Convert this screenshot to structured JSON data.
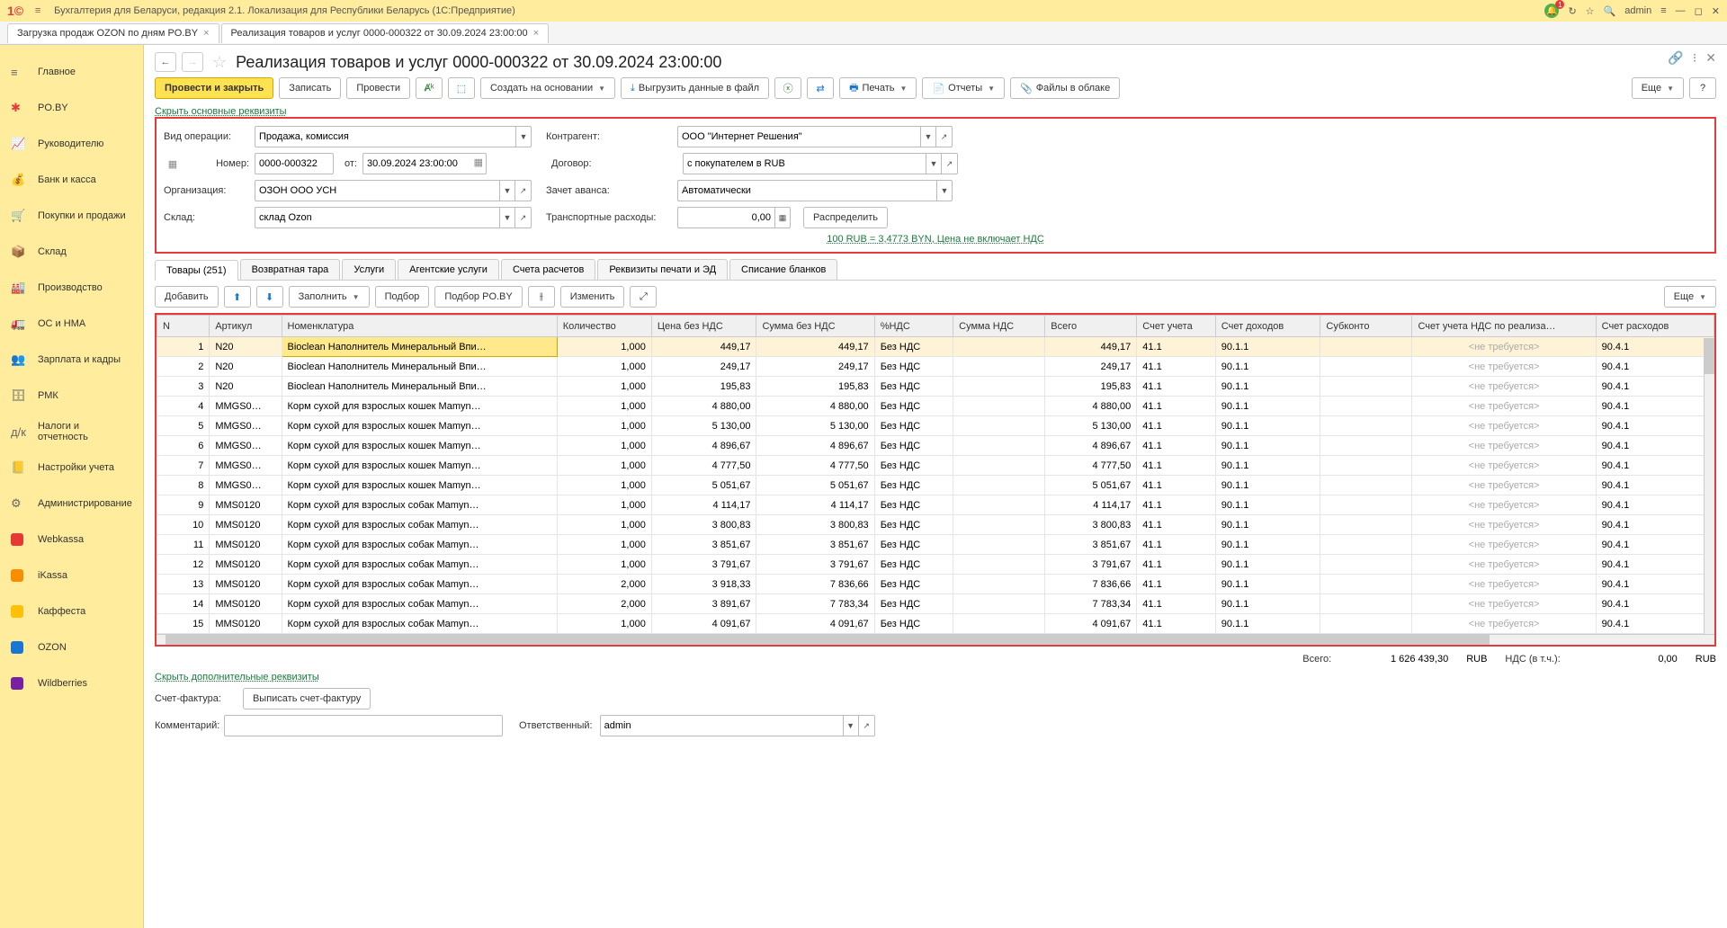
{
  "titlebar": {
    "app": "Бухгалтерия для Беларуси, редакция 2.1. Локализация для Республики Беларусь   (1С:Предприятие)",
    "user": "admin"
  },
  "tabs": [
    {
      "label": "Загрузка продаж OZON по дням PO.BY",
      "active": false
    },
    {
      "label": "Реализация товаров и услуг 0000-000322 от 30.09.2024 23:00:00",
      "active": true
    }
  ],
  "sidebar": [
    "Главное",
    "PO.BY",
    "Руководителю",
    "Банк и касса",
    "Покупки и продажи",
    "Склад",
    "Производство",
    "ОС и НМА",
    "Зарплата и кадры",
    "РМК",
    "Налоги и отчетность",
    "Настройки учета",
    "Администрирование",
    "Webkassa",
    "iKassa",
    "Каффеста",
    "OZON",
    "Wildberries"
  ],
  "doc": {
    "title": "Реализация товаров и услуг 0000-000322 от 30.09.2024 23:00:00",
    "btn_post_close": "Провести и закрыть",
    "btn_write": "Записать",
    "btn_post": "Провести",
    "btn_create_on": "Создать на основании",
    "btn_export": "Выгрузить данные в файл",
    "btn_print": "Печать",
    "btn_reports": "Отчеты",
    "btn_cloud": "Файлы в облаке",
    "btn_more": "Еще",
    "link_hide_main": "Скрыть основные реквизиты",
    "labels": {
      "op_type": "Вид операции:",
      "number": "Номер:",
      "from": "от:",
      "org": "Организация:",
      "wh": "Склад:",
      "contractor": "Контрагент:",
      "contract": "Договор:",
      "advance": "Зачет аванса:",
      "transport": "Транспортные расходы:",
      "distribute": "Распределить"
    },
    "op_type": "Продажа, комиссия",
    "number": "0000-000322",
    "date": "30.09.2024 23:00:00",
    "org": "ОЗОН ООО УСН",
    "wh": "склад Ozon",
    "contractor": "ООО \"Интернет Решения\"",
    "contract": "с покупателем в RUB",
    "advance": "Автоматически",
    "transport": "0,00",
    "rate_link": "100 RUB = 3,4773 BYN, Цена не включает НДС"
  },
  "doc_tabs": [
    "Товары (251)",
    "Возвратная тара",
    "Услуги",
    "Агентские услуги",
    "Счета расчетов",
    "Реквизиты печати и ЭД",
    "Списание бланков"
  ],
  "grid_toolbar": {
    "add": "Добавить",
    "fill": "Заполнить",
    "pick": "Подбор",
    "pick_po": "Подбор PO.BY",
    "change": "Изменить",
    "more": "Еще"
  },
  "columns": [
    "N",
    "Артикул",
    "Номенклатура",
    "Количество",
    "Цена без НДС",
    "Сумма без НДС",
    "%НДС",
    "Сумма НДС",
    "Всего",
    "Счет учета",
    "Счет доходов",
    "Субконто",
    "Счет учета НДС по реализа…",
    "Счет расходов"
  ],
  "rows": [
    {
      "n": 1,
      "art": "N20",
      "nom": "Bioclean Наполнитель Минеральный Впи…",
      "qty": "1,000",
      "price": "449,17",
      "sum": "449,17",
      "vat": "Без НДС",
      "vsum": "",
      "total": "449,17",
      "acc": "41.1",
      "inc": "90.1.1",
      "sub": "",
      "vacc": "<не требуется>",
      "exp": "90.4.1"
    },
    {
      "n": 2,
      "art": "N20",
      "nom": "Bioclean Наполнитель Минеральный Впи…",
      "qty": "1,000",
      "price": "249,17",
      "sum": "249,17",
      "vat": "Без НДС",
      "vsum": "",
      "total": "249,17",
      "acc": "41.1",
      "inc": "90.1.1",
      "sub": "",
      "vacc": "<не требуется>",
      "exp": "90.4.1"
    },
    {
      "n": 3,
      "art": "N20",
      "nom": "Bioclean Наполнитель Минеральный Впи…",
      "qty": "1,000",
      "price": "195,83",
      "sum": "195,83",
      "vat": "Без НДС",
      "vsum": "",
      "total": "195,83",
      "acc": "41.1",
      "inc": "90.1.1",
      "sub": "",
      "vacc": "<не требуется>",
      "exp": "90.4.1"
    },
    {
      "n": 4,
      "art": "MMGS0…",
      "nom": "Корм сухой для взрослых кошек Mamyn…",
      "qty": "1,000",
      "price": "4 880,00",
      "sum": "4 880,00",
      "vat": "Без НДС",
      "vsum": "",
      "total": "4 880,00",
      "acc": "41.1",
      "inc": "90.1.1",
      "sub": "",
      "vacc": "<не требуется>",
      "exp": "90.4.1"
    },
    {
      "n": 5,
      "art": "MMGS0…",
      "nom": "Корм сухой для взрослых кошек Mamyn…",
      "qty": "1,000",
      "price": "5 130,00",
      "sum": "5 130,00",
      "vat": "Без НДС",
      "vsum": "",
      "total": "5 130,00",
      "acc": "41.1",
      "inc": "90.1.1",
      "sub": "",
      "vacc": "<не требуется>",
      "exp": "90.4.1"
    },
    {
      "n": 6,
      "art": "MMGS0…",
      "nom": "Корм сухой для взрослых кошек Mamyn…",
      "qty": "1,000",
      "price": "4 896,67",
      "sum": "4 896,67",
      "vat": "Без НДС",
      "vsum": "",
      "total": "4 896,67",
      "acc": "41.1",
      "inc": "90.1.1",
      "sub": "",
      "vacc": "<не требуется>",
      "exp": "90.4.1"
    },
    {
      "n": 7,
      "art": "MMGS0…",
      "nom": "Корм сухой для взрослых кошек Mamyn…",
      "qty": "1,000",
      "price": "4 777,50",
      "sum": "4 777,50",
      "vat": "Без НДС",
      "vsum": "",
      "total": "4 777,50",
      "acc": "41.1",
      "inc": "90.1.1",
      "sub": "",
      "vacc": "<не требуется>",
      "exp": "90.4.1"
    },
    {
      "n": 8,
      "art": "MMGS0…",
      "nom": "Корм сухой для взрослых кошек Mamyn…",
      "qty": "1,000",
      "price": "5 051,67",
      "sum": "5 051,67",
      "vat": "Без НДС",
      "vsum": "",
      "total": "5 051,67",
      "acc": "41.1",
      "inc": "90.1.1",
      "sub": "",
      "vacc": "<не требуется>",
      "exp": "90.4.1"
    },
    {
      "n": 9,
      "art": "MMS0120",
      "nom": "Корм сухой для взрослых собак Mamyn…",
      "qty": "1,000",
      "price": "4 114,17",
      "sum": "4 114,17",
      "vat": "Без НДС",
      "vsum": "",
      "total": "4 114,17",
      "acc": "41.1",
      "inc": "90.1.1",
      "sub": "",
      "vacc": "<не требуется>",
      "exp": "90.4.1"
    },
    {
      "n": 10,
      "art": "MMS0120",
      "nom": "Корм сухой для взрослых собак Mamyn…",
      "qty": "1,000",
      "price": "3 800,83",
      "sum": "3 800,83",
      "vat": "Без НДС",
      "vsum": "",
      "total": "3 800,83",
      "acc": "41.1",
      "inc": "90.1.1",
      "sub": "",
      "vacc": "<не требуется>",
      "exp": "90.4.1"
    },
    {
      "n": 11,
      "art": "MMS0120",
      "nom": "Корм сухой для взрослых собак Mamyn…",
      "qty": "1,000",
      "price": "3 851,67",
      "sum": "3 851,67",
      "vat": "Без НДС",
      "vsum": "",
      "total": "3 851,67",
      "acc": "41.1",
      "inc": "90.1.1",
      "sub": "",
      "vacc": "<не требуется>",
      "exp": "90.4.1"
    },
    {
      "n": 12,
      "art": "MMS0120",
      "nom": "Корм сухой для взрослых собак Mamyn…",
      "qty": "1,000",
      "price": "3 791,67",
      "sum": "3 791,67",
      "vat": "Без НДС",
      "vsum": "",
      "total": "3 791,67",
      "acc": "41.1",
      "inc": "90.1.1",
      "sub": "",
      "vacc": "<не требуется>",
      "exp": "90.4.1"
    },
    {
      "n": 13,
      "art": "MMS0120",
      "nom": "Корм сухой для взрослых собак Mamyn…",
      "qty": "2,000",
      "price": "3 918,33",
      "sum": "7 836,66",
      "vat": "Без НДС",
      "vsum": "",
      "total": "7 836,66",
      "acc": "41.1",
      "inc": "90.1.1",
      "sub": "",
      "vacc": "<не требуется>",
      "exp": "90.4.1"
    },
    {
      "n": 14,
      "art": "MMS0120",
      "nom": "Корм сухой для взрослых собак Mamyn…",
      "qty": "2,000",
      "price": "3 891,67",
      "sum": "7 783,34",
      "vat": "Без НДС",
      "vsum": "",
      "total": "7 783,34",
      "acc": "41.1",
      "inc": "90.1.1",
      "sub": "",
      "vacc": "<не требуется>",
      "exp": "90.4.1"
    },
    {
      "n": 15,
      "art": "MMS0120",
      "nom": "Корм сухой для взрослых собак Mamyn…",
      "qty": "1,000",
      "price": "4 091,67",
      "sum": "4 091,67",
      "vat": "Без НДС",
      "vsum": "",
      "total": "4 091,67",
      "acc": "41.1",
      "inc": "90.1.1",
      "sub": "",
      "vacc": "<не требуется>",
      "exp": "90.4.1"
    }
  ],
  "totals": {
    "total_lbl": "Всего:",
    "total": "1 626 439,30",
    "cur1": "RUB",
    "vat_lbl": "НДС (в т.ч.):",
    "vat": "0,00",
    "cur2": "RUB"
  },
  "footer": {
    "link_extra": "Скрыть дополнительные реквизиты",
    "sf_lbl": "Счет-фактура:",
    "sf_btn": "Выписать счет-фактуру",
    "comment_lbl": "Комментарий:",
    "resp_lbl": "Ответственный:",
    "resp": "admin"
  }
}
